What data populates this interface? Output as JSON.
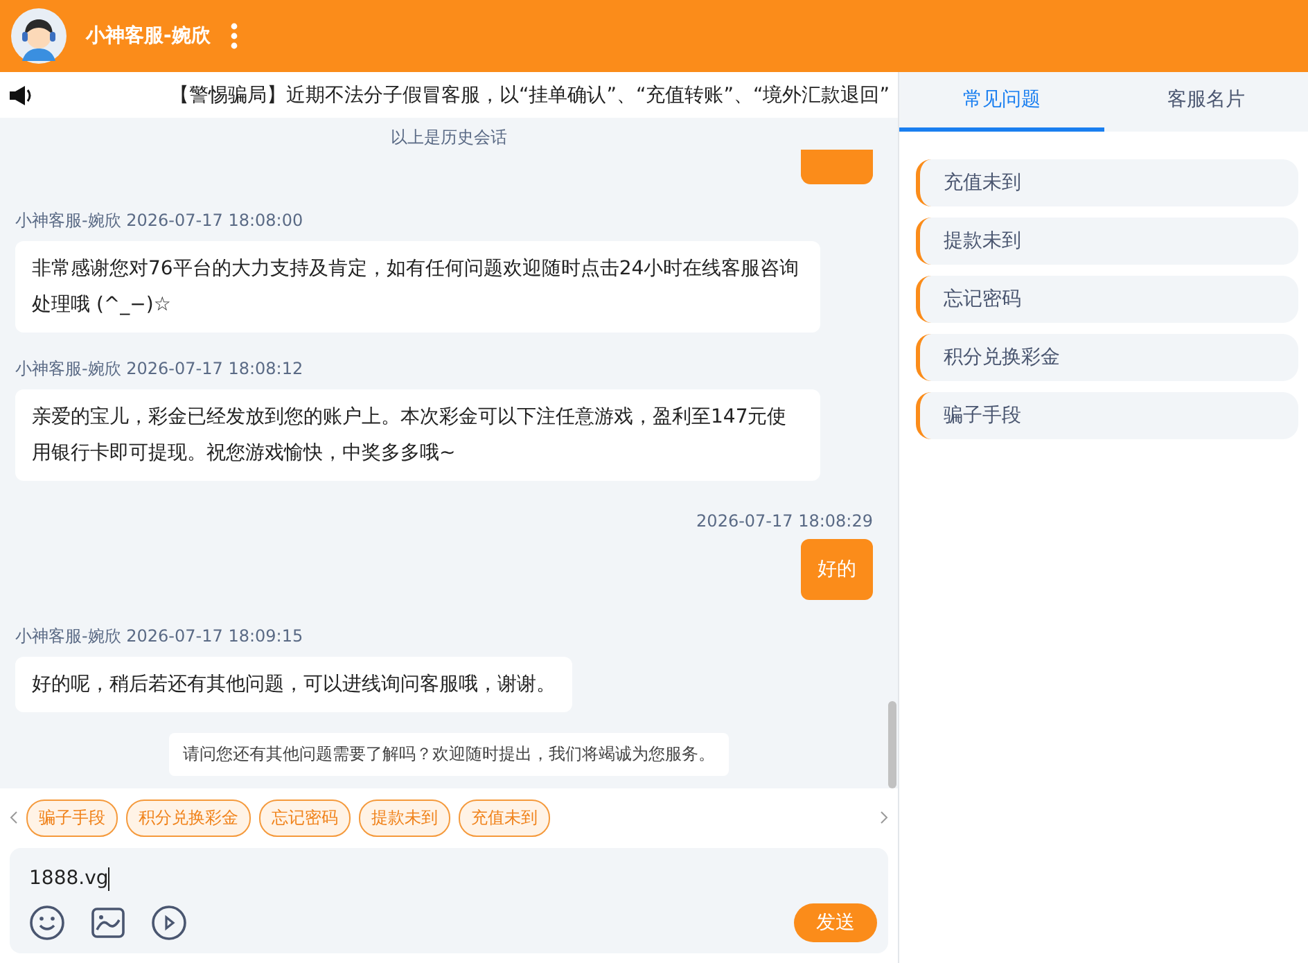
{
  "header": {
    "agent_name": "小神客服-婉欣"
  },
  "notice_bar": {
    "text": "【警惕骗局】近期不法分子假冒客服，以“挂单确认”、“充值转账”、“境外汇款退回”"
  },
  "chat": {
    "history_label": "以上是历史会话",
    "messages": [
      {
        "kind": "agent",
        "sender": "小神客服-婉欣",
        "time": "2026-07-17 18:08:00",
        "text": "非常感谢您对76平台的大力支持及肯定，如有任何问题欢迎随时点击24小时在线客服咨询处理哦 (^_−)☆"
      },
      {
        "kind": "agent",
        "sender": "小神客服-婉欣",
        "time": "2026-07-17 18:08:12",
        "text": "亲爱的宝儿，彩金已经发放到您的账户上。本次彩金可以下注任意游戏，盈利至147元使用银行卡即可提现。祝您游戏愉快，中奖多多哦~"
      },
      {
        "kind": "user",
        "time": "2026-07-17 18:08:29",
        "text": "好的"
      },
      {
        "kind": "agent",
        "sender": "小神客服-婉欣",
        "time": "2026-07-17 18:09:15",
        "text": "好的呢，稍后若还有其他问题，可以进线询问客服哦，谢谢。"
      },
      {
        "kind": "notice",
        "text": "请问您还有其他问题需要了解吗？欢迎随时提出，我们将竭诚为您服务。"
      }
    ]
  },
  "quick_replies": [
    "骗子手段",
    "积分兑换彩金",
    "忘记密码",
    "提款未到",
    "充值未到"
  ],
  "composer": {
    "value": "1888.vg",
    "send_label": "发送"
  },
  "side_panel": {
    "tabs": [
      {
        "label": "常见问题",
        "selected": true
      },
      {
        "label": "客服名片",
        "selected": false
      }
    ],
    "faq": [
      "充值未到",
      "提款未到",
      "忘记密码",
      "积分兑换彩金",
      "骗子手段"
    ]
  }
}
